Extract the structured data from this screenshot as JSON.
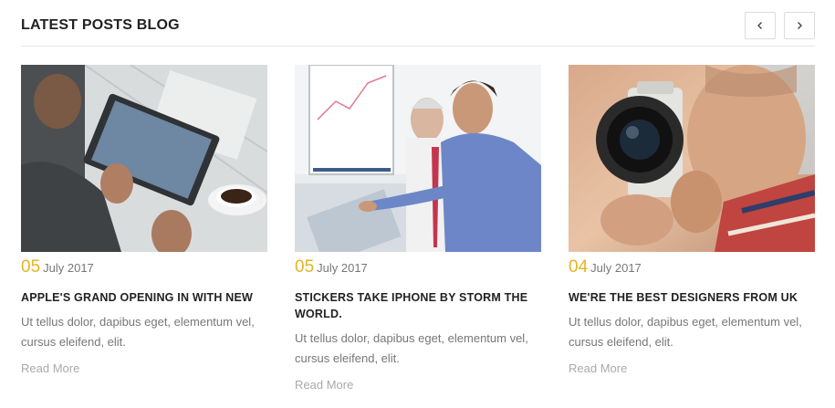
{
  "section": {
    "title": "LATEST POSTS BLOG"
  },
  "nav": {
    "prev_icon": "chevron-left-icon",
    "next_icon": "chevron-right-icon"
  },
  "posts": [
    {
      "day": "05",
      "month_year": "July 2017",
      "title": "APPLE'S GRAND OPENING IN WITH NEW",
      "excerpt": "Ut tellus dolor, dapibus eget, elementum vel, cursus eleifend, elit.",
      "read_more": "Read More",
      "image": "tablet-coffee-photo"
    },
    {
      "day": "05",
      "month_year": "July 2017",
      "title": "STICKERS TAKE IPHONE BY STORM THE WORLD.",
      "excerpt": "Ut tellus dolor, dapibus eget, elementum vel, cursus eleifend, elit.",
      "read_more": "Read More",
      "image": "business-meeting-photo"
    },
    {
      "day": "04",
      "month_year": "July 2017",
      "title": "WE'RE THE BEST DESIGNERS FROM UK",
      "excerpt": "Ut tellus dolor, dapibus eget, elementum vel, cursus eleifend, elit.",
      "read_more": "Read More",
      "image": "camera-operator-photo"
    }
  ],
  "colors": {
    "accent": "#e4b422",
    "text_muted": "#777777",
    "link_muted": "#aaaaaa"
  }
}
